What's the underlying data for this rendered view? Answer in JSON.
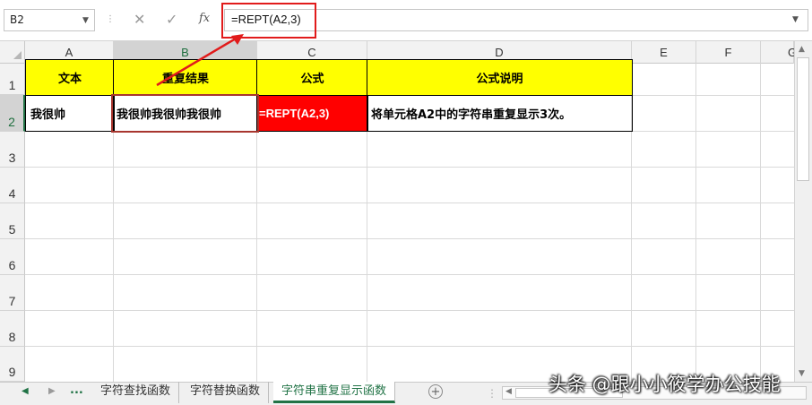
{
  "name_box": {
    "value": "B2"
  },
  "formula_bar": {
    "fx_label": "fx",
    "formula": "=REPT(A2,3)"
  },
  "columns": [
    "A",
    "B",
    "C",
    "D",
    "E",
    "F",
    "G"
  ],
  "rows": [
    "1",
    "2",
    "3",
    "4",
    "5",
    "6",
    "7",
    "8",
    "9"
  ],
  "selected_cell": "B2",
  "table": {
    "headers": [
      "文本",
      "重复结果",
      "公式",
      "公式说明"
    ],
    "row2": [
      "我很帅",
      "我很帅我很帅我很帅",
      "=REPT(A2,3)",
      "将单元格A2中的字符串重复显示3次。"
    ]
  },
  "sheet_tabs": [
    {
      "label": "字符查找函数",
      "active": false
    },
    {
      "label": "字符替换函数",
      "active": false
    },
    {
      "label": "字符串重复显示函数",
      "active": true
    }
  ],
  "tab_nav": {
    "more": "..."
  },
  "watermark": "头条 @跟小小筱学办公技能",
  "colors": {
    "header_fill": "#ffff00",
    "formula_cell_fill": "#ff0000",
    "annotation_red": "#e11b1b",
    "active_green": "#217346"
  },
  "icons": [
    "chevron-down-icon",
    "cancel-x-icon",
    "check-icon",
    "fx-icon",
    "add-sheet-icon",
    "arrow-left-icon",
    "arrow-right-icon",
    "arrow-up-icon",
    "arrow-down-icon",
    "annotation-arrow-icon"
  ]
}
